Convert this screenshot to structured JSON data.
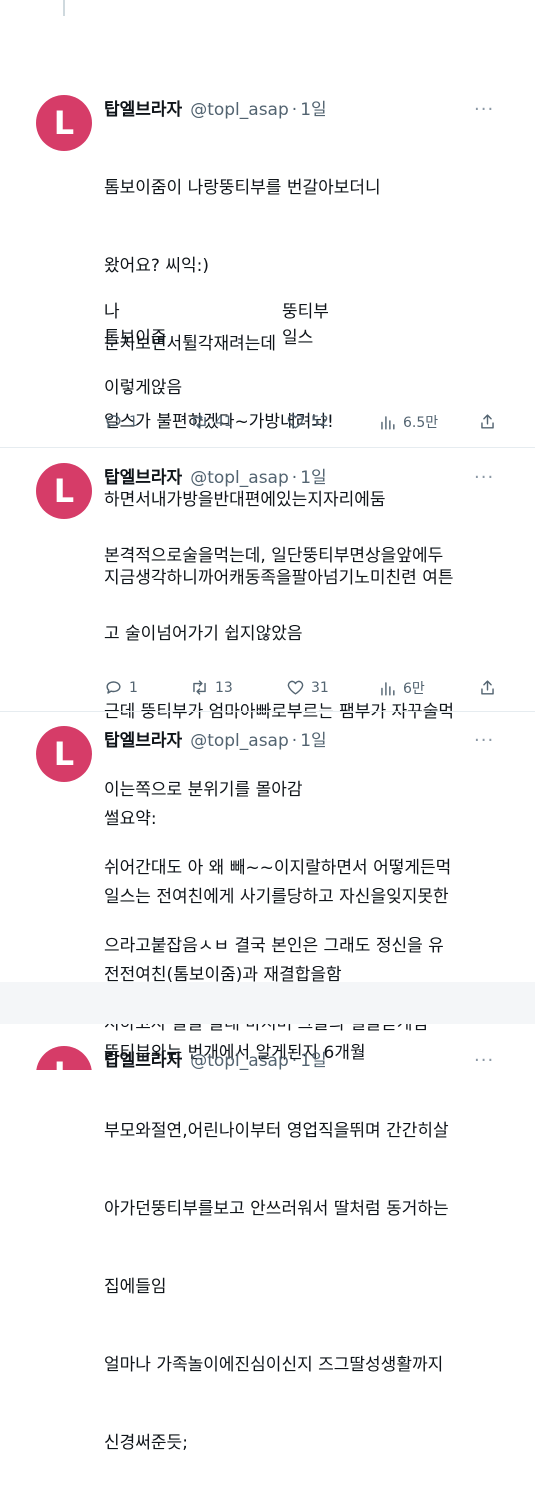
{
  "colors": {
    "avatar_bg": "#d63c68",
    "muted": "#536471",
    "text": "#0f1419"
  },
  "avatar_letter": "L",
  "author": {
    "name": "탑엘브라자",
    "handle": "@topl_asap",
    "time": "1일"
  },
  "more_label": "···",
  "tweets": [
    {
      "lines": [
        "톰보이줌이 나랑뚱티부를 번갈아보더니",
        "왔어요? 씨익:)",
        "눈치보면서튈각재려는데",
        "일스가 불편하겠다~가방내려놔!",
        "하면서내가방을반대편에있는지자리에둠",
        "지금생각하니까어캐동족을팔아넘기노미친련 여튼"
      ],
      "pairs": [
        [
          "나",
          "뚱티부"
        ],
        [
          "톰보이줌",
          "일스"
        ]
      ],
      "closing": "이렇게앉음",
      "stats": {
        "replies": "1",
        "retweets": "41",
        "likes": "52",
        "views": "6.5만"
      }
    },
    {
      "lines": [
        "본격적으로술을먹는데, 일단뚱티부면상을앞에두",
        "고 술이넘어가기 쉽지않았음",
        "근데 뚱티부가 엄마아빠로부르는 팸부가 자꾸술먹",
        "이는쪽으로 분위기를 몰아감",
        "쉬어간대도 아 왜 빼~~이지랄하면서 어떻게든먹",
        "으라고붙잡음ㅅㅂ 결국 본인은 그래도 정신을 유",
        "지하고자 물을 몰래 마시며 그들의 썰을듣게됨"
      ],
      "stats": {
        "replies": "1",
        "retweets": "13",
        "likes": "31",
        "views": "6만"
      }
    },
    {
      "lines": [
        "썰요약:",
        "일스는 전여친에게 사기를당하고 자신을잊지못한",
        "전전여친(톰보이줌)과 재결합을함",
        "뚱티부와는 번개에서 알게된지 6개월",
        "부모와절연,어린나이부터 영업직을뛰며 간간히살",
        "아가던뚱티부를보고 안쓰러워서 딸처럼 동거하는",
        "집에들임",
        "얼마나 가족놀이에진심이신지 즈그딸성생활까지",
        "신경써준듯;"
      ]
    },
    {
      "lines": []
    }
  ]
}
